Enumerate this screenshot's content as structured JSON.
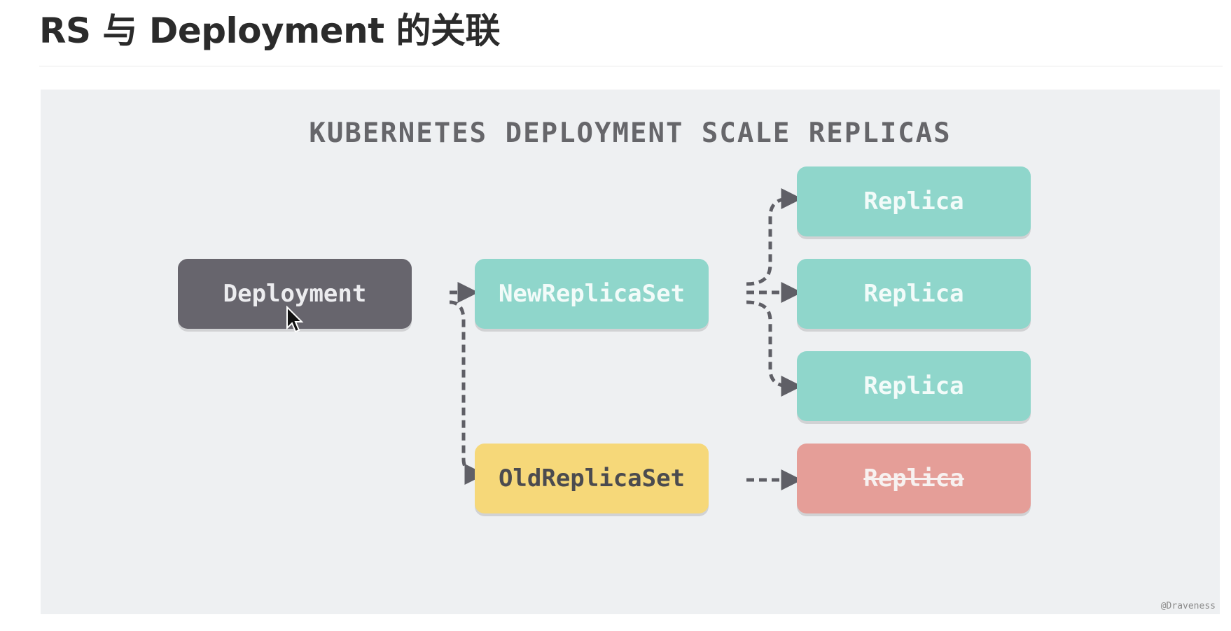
{
  "page": {
    "title": "RS 与 Deployment  的关联"
  },
  "diagram": {
    "title": "KUBERNETES DEPLOYMENT SCALE REPLICAS",
    "watermark": "@Draveness",
    "nodes": {
      "deployment": "Deployment",
      "new_replica_set": "NewReplicaSet",
      "old_replica_set": "OldReplicaSet",
      "replica_1": "Replica",
      "replica_2": "Replica",
      "replica_3": "Replica",
      "replica_old": "Replica"
    },
    "colors": {
      "deployment": "#67656d",
      "replica_set_new": "#8fd6cb",
      "replica_set_old": "#f6d879",
      "replica_removed": "#e59e98",
      "connector": "#5f5f66"
    },
    "icons": {
      "cursor": "mouse-pointer-icon"
    }
  }
}
